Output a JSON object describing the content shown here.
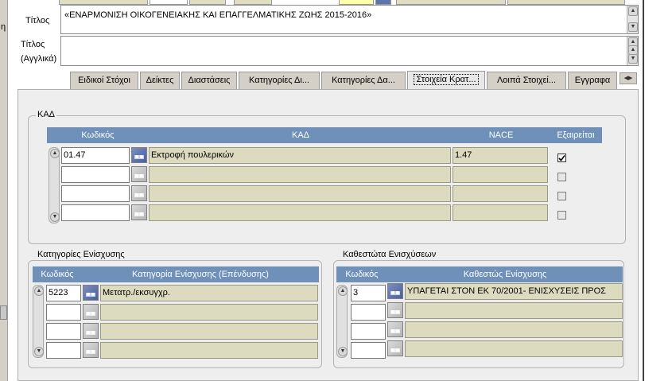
{
  "form": {
    "title_label": "Τίτλος",
    "title_value": "«ΕΝΑΡΜΟΝΙΣΗ ΟΙΚΟΓΕΝΕΙΑΚΗΣ ΚΑΙ ΕΠΑΓΓΕΛΜΑΤΙΚΗΣ ΖΩΗΣ 2015-2016»",
    "title_en_label_line1": "Τίτλος",
    "title_en_label_line2": "(Αγγλικά)",
    "title_en_value": ""
  },
  "tabs": [
    {
      "label": "Ειδικοί Στόχοι"
    },
    {
      "label": "Δείκτες"
    },
    {
      "label": "Διαστάσεις"
    },
    {
      "label": "Κατηγορίες Δι..."
    },
    {
      "label": "Κατηγορίες Δα..."
    },
    {
      "label": "Στοιχεία Κρατ...",
      "active": true
    },
    {
      "label": "Λοιπά Στοιχεί..."
    },
    {
      "label": "Εγγραφα"
    }
  ],
  "kad": {
    "legend": "ΚΑΔ",
    "headers": {
      "code": "Κωδικός",
      "kad": "ΚΑΔ",
      "nace": "NACE",
      "excluded": "Εξαιρείται"
    },
    "rows": [
      {
        "code": "01.47",
        "desc": "Εκτροφή πουλερικών",
        "nace": "1.47",
        "excluded": true
      },
      {
        "code": "",
        "desc": "",
        "nace": "",
        "excluded": false
      },
      {
        "code": "",
        "desc": "",
        "nace": "",
        "excluded": false
      },
      {
        "code": "",
        "desc": "",
        "nace": "",
        "excluded": false
      }
    ]
  },
  "support_categories": {
    "legend": "Κατηγορίες Ενίσχυσης",
    "headers": {
      "code": "Κωδικός",
      "category": "Κατηγορία Ενίσχυσης (Επένδυσης)"
    },
    "rows": [
      {
        "code": "5223",
        "desc": "Μετατρ./εκσυγχρ."
      },
      {
        "code": "",
        "desc": ""
      },
      {
        "code": "",
        "desc": ""
      },
      {
        "code": "",
        "desc": ""
      }
    ]
  },
  "support_regimes": {
    "legend": "Καθεστώτα Ενισχύσεων",
    "headers": {
      "code": "Κωδικός",
      "regime": "Καθεστώς Ενίσχυσης"
    },
    "rows": [
      {
        "code": "3",
        "desc": "ΥΠΑΓΕΤΑΙ ΣΤΟΝ ΕΚ 70/2001- ΕΝΙΣΧΥΣΕΙΣ ΠΡΟΣ"
      },
      {
        "code": "",
        "desc": ""
      },
      {
        "code": "",
        "desc": ""
      },
      {
        "code": "",
        "desc": ""
      }
    ]
  },
  "icons": {
    "lov": "list-of-values-icon",
    "check": "checkmark-icon",
    "scroll_up": "arrow-up-icon",
    "scroll_down": "arrow-down-icon",
    "tab_scroll": "tab-scroll-arrows-icon"
  },
  "colors": {
    "header_bg": "#6f90b8",
    "readonly_bg": "#dcdbc0",
    "panel_bg": "#eeeeee"
  }
}
